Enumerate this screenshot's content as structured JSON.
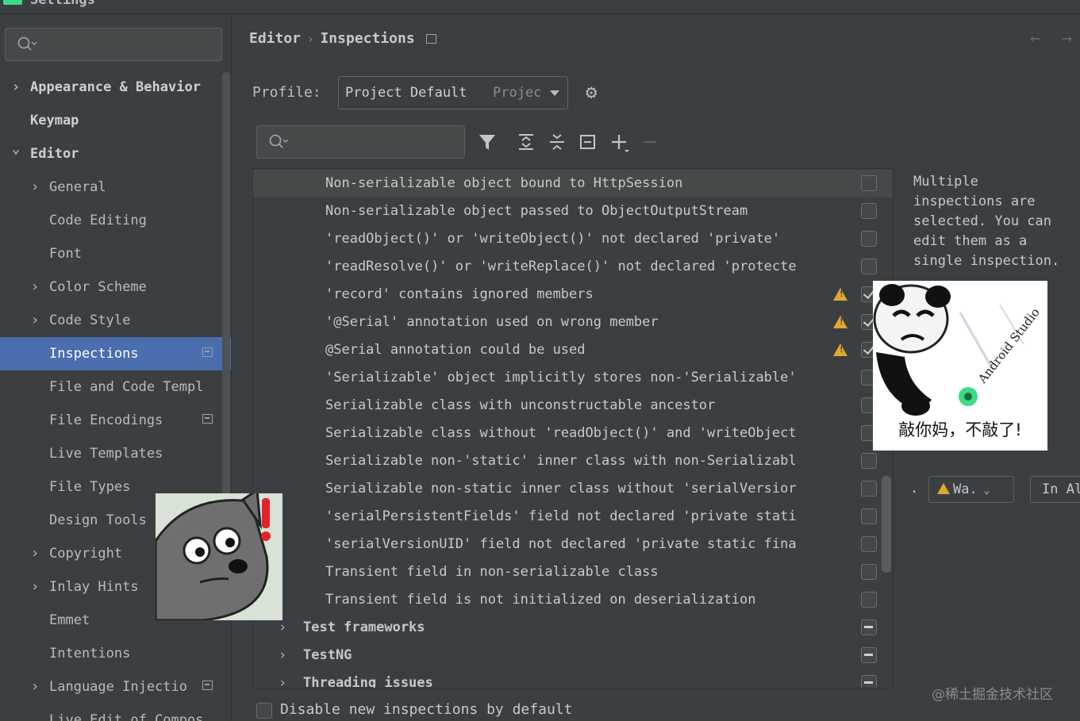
{
  "window": {
    "title": "Settings"
  },
  "search": {
    "placeholder": ""
  },
  "sidebar": {
    "items": [
      {
        "label": "Appearance & Behavior",
        "indent": 0,
        "chevron": "right",
        "bold": true
      },
      {
        "label": "Keymap",
        "indent": 0,
        "chevron": "",
        "bold": true
      },
      {
        "label": "Editor",
        "indent": 0,
        "chevron": "down",
        "bold": true
      },
      {
        "label": "General",
        "indent": 1,
        "chevron": "right"
      },
      {
        "label": "Code Editing",
        "indent": 1,
        "chevron": ""
      },
      {
        "label": "Font",
        "indent": 1,
        "chevron": ""
      },
      {
        "label": "Color Scheme",
        "indent": 1,
        "chevron": "right"
      },
      {
        "label": "Code Style",
        "indent": 1,
        "chevron": "right"
      },
      {
        "label": "Inspections",
        "indent": 1,
        "chevron": "",
        "selected": true,
        "project_icon": true
      },
      {
        "label": "File and Code Templ",
        "indent": 1,
        "chevron": ""
      },
      {
        "label": "File Encodings",
        "indent": 1,
        "chevron": "",
        "project_icon": true
      },
      {
        "label": "Live Templates",
        "indent": 1,
        "chevron": ""
      },
      {
        "label": "File Types",
        "indent": 1,
        "chevron": ""
      },
      {
        "label": "Design Tools",
        "indent": 1,
        "chevron": ""
      },
      {
        "label": "Copyright",
        "indent": 1,
        "chevron": "right"
      },
      {
        "label": "Inlay Hints",
        "indent": 1,
        "chevron": "right"
      },
      {
        "label": "Emmet",
        "indent": 1,
        "chevron": ""
      },
      {
        "label": "Intentions",
        "indent": 1,
        "chevron": ""
      },
      {
        "label": "Language Injectio",
        "indent": 1,
        "chevron": "right",
        "project_icon": true
      },
      {
        "label": "Live Edit of Compos",
        "indent": 1,
        "chevron": ""
      }
    ]
  },
  "breadcrumb": {
    "parent": "Editor",
    "separator": "›",
    "current": "Inspections"
  },
  "profile": {
    "label": "Profile:",
    "value": "Project Default",
    "scope": "Project"
  },
  "list": {
    "rows": [
      {
        "text": "Non-serializable object bound to HttpSession",
        "state": "unchecked",
        "hover": true
      },
      {
        "text": "Non-serializable object passed to ObjectOutputStream",
        "state": "unchecked"
      },
      {
        "text": "'readObject()' or 'writeObject()' not declared 'private'",
        "state": "unchecked"
      },
      {
        "text": "'readResolve()' or 'writeReplace()' not declared 'protecte",
        "state": "unchecked"
      },
      {
        "text": "'record' contains ignored members",
        "state": "checked",
        "warning": true
      },
      {
        "text": "'@Serial' annotation used on wrong member",
        "state": "checked",
        "warning": true
      },
      {
        "text": "@Serial annotation could be used",
        "state": "checked",
        "warning": true
      },
      {
        "text": "'Serializable' object implicitly stores non-'Serializable'",
        "state": "unchecked"
      },
      {
        "text": "Serializable class with unconstructable ancestor",
        "state": "unchecked"
      },
      {
        "text": "Serializable class without 'readObject()' and 'writeObject",
        "state": "unchecked"
      },
      {
        "text": "Serializable non-'static' inner class with non-Serializabl",
        "state": "unchecked"
      },
      {
        "text": "Serializable non-static inner class without 'serialVersior",
        "state": "unchecked"
      },
      {
        "text": "'serialPersistentFields' field not declared 'private stati",
        "state": "unchecked"
      },
      {
        "text": "'serialVersionUID' field not declared 'private static fina",
        "state": "unchecked"
      },
      {
        "text": "Transient field in non-serializable class",
        "state": "unchecked"
      },
      {
        "text": "Transient field is not initialized on deserialization",
        "state": "unchecked"
      },
      {
        "text": "Test frameworks",
        "state": "partial",
        "group": true
      },
      {
        "text": "TestNG",
        "state": "partial",
        "group": true
      },
      {
        "text": "Threading issues",
        "state": "partial",
        "group": true
      }
    ]
  },
  "description": {
    "lines": [
      "Multiple",
      "inspections are",
      "selected. You can",
      "edit them as a",
      "single inspection."
    ]
  },
  "severity": {
    "dot": ".",
    "warning_label": "Wa.",
    "scope_label": "In Al"
  },
  "footer": {
    "disable_new_label": "Disable new inspections by default"
  },
  "stickers": {
    "panda_caption": "敲你妈，不敲了!",
    "panda_tag": "Android Studio"
  },
  "watermark": "@稀土掘金技术社区",
  "colors": {
    "background": "#3c3f41",
    "selection": "#4b6eaf",
    "warning": "#e0a82e",
    "text": "#bbbbbb"
  }
}
